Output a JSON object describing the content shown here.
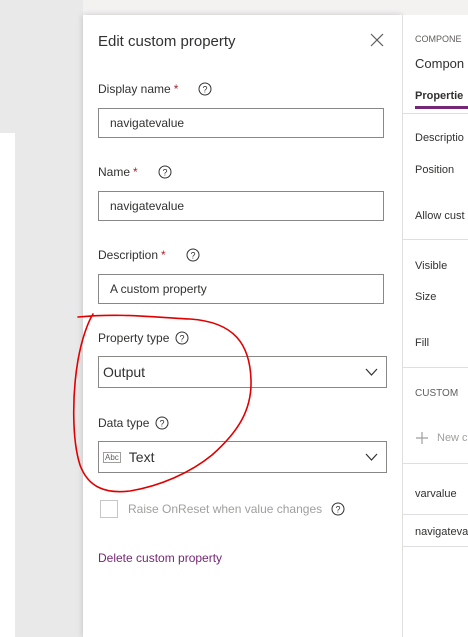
{
  "panel": {
    "title": "Edit custom property",
    "display_name": {
      "label": "Display name",
      "required": "*",
      "value": "navigatevalue"
    },
    "name": {
      "label": "Name",
      "required": "*",
      "value": "navigatevalue"
    },
    "description": {
      "label": "Description",
      "required": "*",
      "value": "A custom property"
    },
    "property_type": {
      "label": "Property type",
      "value": "Output"
    },
    "data_type": {
      "label": "Data type",
      "icon_text": "Abc",
      "value": "Text"
    },
    "raise_onreset": {
      "label": "Raise OnReset when value changes",
      "checked": false
    },
    "delete_link": "Delete custom property"
  },
  "right_pane": {
    "header": "COMPONE",
    "subheader": "Compon",
    "tab": "Propertie",
    "items": [
      "Descriptio",
      "Position",
      "Allow cust",
      "Visible",
      "Size",
      "Fill"
    ],
    "custom_header": "CUSTOM",
    "new_button": "New c",
    "props": [
      "varvalue",
      "navigateva"
    ]
  },
  "colors": {
    "accent": "#742774",
    "required": "#a4262c",
    "annotation": "#e00000"
  }
}
